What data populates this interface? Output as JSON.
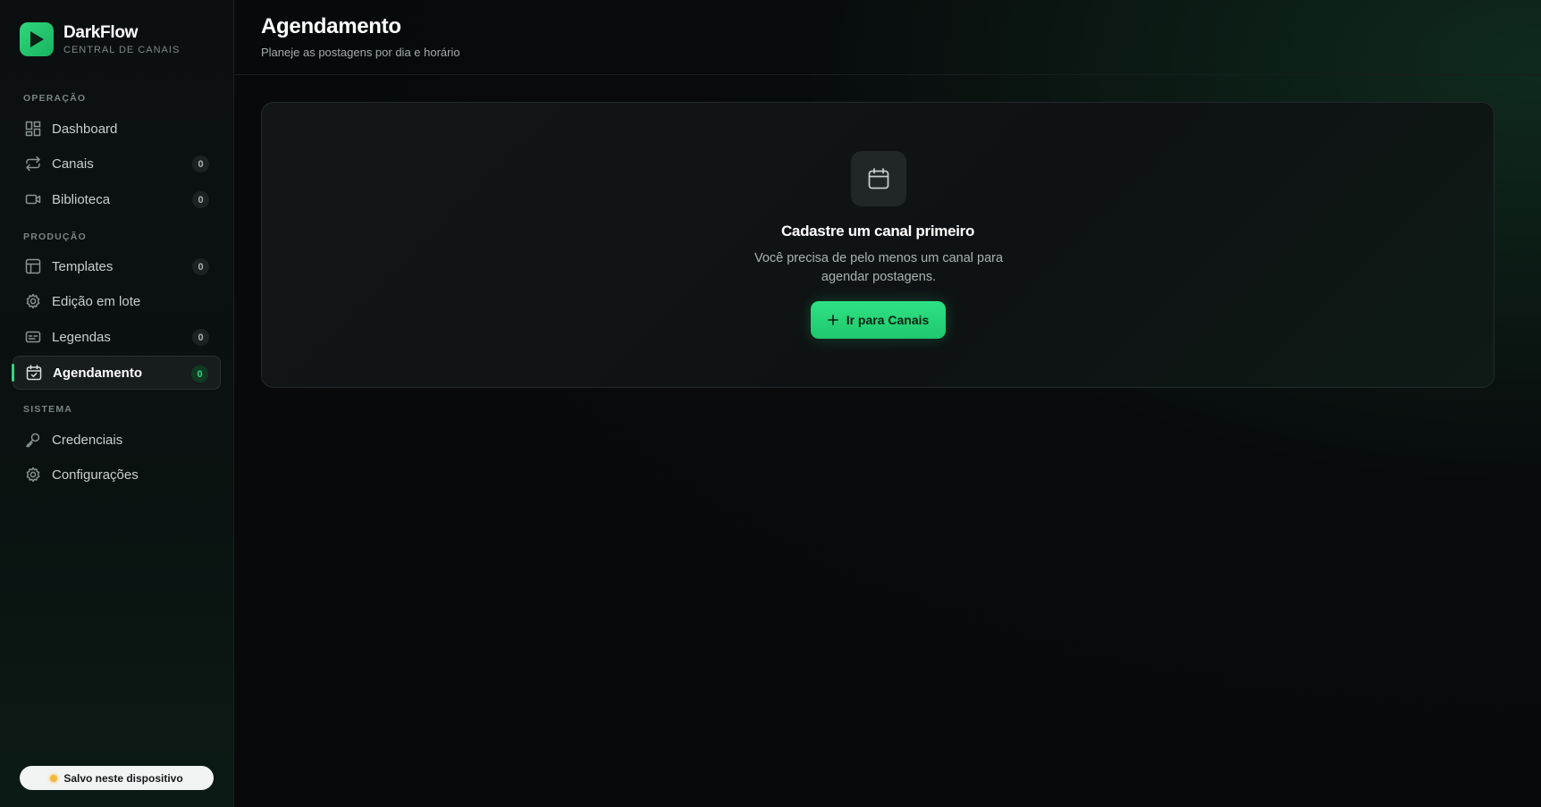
{
  "brand": {
    "name": "DarkFlow",
    "subtitle": "CENTRAL DE CANAIS",
    "logo_icon": "play-icon",
    "accent": "#2fd67a"
  },
  "sidebar": {
    "sections": [
      {
        "label": "OPERAÇÃO"
      },
      {
        "label": "PRODUÇÃO"
      },
      {
        "label": "SISTEMA"
      }
    ],
    "items": [
      {
        "label": "Dashboard",
        "icon": "dashboard-grid-icon",
        "badge": null
      },
      {
        "label": "Canais",
        "icon": "repeat-arrows-icon",
        "badge": "0"
      },
      {
        "label": "Biblioteca",
        "icon": "video-camera-icon",
        "badge": "0"
      },
      {
        "label": "Templates",
        "icon": "layout-template-icon",
        "badge": "0"
      },
      {
        "label": "Edição em lote",
        "icon": "gear-icon",
        "badge": null
      },
      {
        "label": "Legendas",
        "icon": "captions-icon",
        "badge": "0"
      },
      {
        "label": "Agendamento",
        "icon": "calendar-check-icon",
        "badge": "0",
        "active": true
      },
      {
        "label": "Credenciais",
        "icon": "key-icon",
        "badge": null
      },
      {
        "label": "Configurações",
        "icon": "settings-icon",
        "badge": null
      }
    ],
    "footer_status": "Salvo neste dispositivo"
  },
  "header": {
    "title": "Agendamento",
    "subtitle": "Planeje as postagens por dia e horário"
  },
  "empty_state": {
    "icon": "calendar-icon",
    "title": "Cadastre um canal primeiro",
    "description": "Você precisa de pelo menos um canal para agendar postagens.",
    "button_label": "Ir para Canais"
  }
}
